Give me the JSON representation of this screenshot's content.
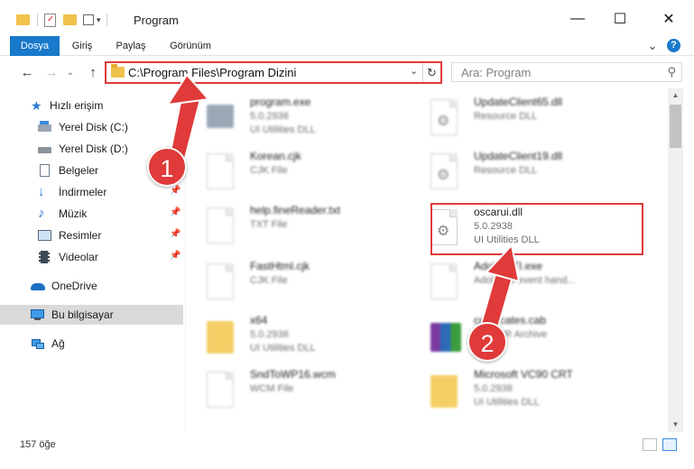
{
  "window": {
    "title": "Program",
    "minimize": "—",
    "maximize": "☐",
    "close": "✕"
  },
  "ribbon": {
    "tabs": [
      "Dosya",
      "Giriş",
      "Paylaş",
      "Görünüm"
    ],
    "active_tab": "Dosya",
    "expand": "⌄",
    "help": "?"
  },
  "address": {
    "path": "C:\\Program Files\\Program Dizini",
    "search_placeholder": "Ara: Program",
    "back": "←",
    "forward": "→",
    "recent": "⌄",
    "up": "↑",
    "refresh": "↻",
    "dropdown": "⌄",
    "search_icon": "⚲"
  },
  "nav": {
    "quick_access": "Hızlı erişim",
    "items": [
      {
        "label": "Yerel Disk (C:)",
        "icon": "drive-icon",
        "pinned": false
      },
      {
        "label": "Yerel Disk (D:)",
        "icon": "drive-icon",
        "pinned": true
      },
      {
        "label": "Belgeler",
        "icon": "documents-icon",
        "pinned": true
      },
      {
        "label": "İndirmeler",
        "icon": "download-icon",
        "pinned": true
      },
      {
        "label": "Müzik",
        "icon": "music-icon",
        "pinned": true
      },
      {
        "label": "Resimler",
        "icon": "pictures-icon",
        "pinned": true
      },
      {
        "label": "Videolar",
        "icon": "videos-icon",
        "pinned": true
      }
    ],
    "onedrive": "OneDrive",
    "this_pc": "Bu bilgisayar",
    "network": "Ağ"
  },
  "files": {
    "left": [
      {
        "name": "program.exe",
        "line2": "5.0.2938",
        "line3": "UI Utilities DLL",
        "icon": "exe-icon"
      },
      {
        "name": "Korean.cjk",
        "line2": "CJK File",
        "line3": "",
        "icon": "document-icon"
      },
      {
        "name": "help.fineReader.txt",
        "line2": "TXT File",
        "line3": "",
        "icon": "document-icon"
      },
      {
        "name": "FastHtml.cjk",
        "line2": "CJK File",
        "line3": "",
        "icon": "document-icon"
      },
      {
        "name": "x64",
        "line2": "5.0.2938",
        "line3": "UI Utilities DLL",
        "icon": "folder-icon"
      },
      {
        "name": "SndToWP16.wcm",
        "line2": "WCM File",
        "line3": "",
        "icon": "document-icon"
      }
    ],
    "right": [
      {
        "name": "UpdateClient65.dll",
        "line2": "Resource DLL",
        "line3": "",
        "icon": "dll-icon"
      },
      {
        "name": "UpdateClient19.dll",
        "line2": "Resource DLL",
        "line3": "",
        "icon": "dll-icon"
      },
      {
        "name": "oscarui.dll",
        "line2": "5.0.2938",
        "line3": "UI Utilities DLL",
        "icon": "dll-icon"
      },
      {
        "name": "AdobeSTI.exe",
        "line2": "Adobe sti event hand...",
        "line3": "",
        "icon": "document-icon"
      },
      {
        "name": "certificates.cab",
        "line2": "WinRAR Archive",
        "line3": "",
        "icon": "winrar-icon"
      },
      {
        "name": "Microsoft VC90 CRT",
        "line2": "5.0.2938",
        "line3": "UI Utilities DLL",
        "icon": "folder-icon"
      }
    ]
  },
  "status": {
    "count": "157 öğe"
  },
  "annotations": {
    "step1": "1",
    "step2": "2",
    "color": "#e03a3a"
  },
  "colors": {
    "accent": "#1979ca",
    "selection": "#d9d9d9"
  }
}
